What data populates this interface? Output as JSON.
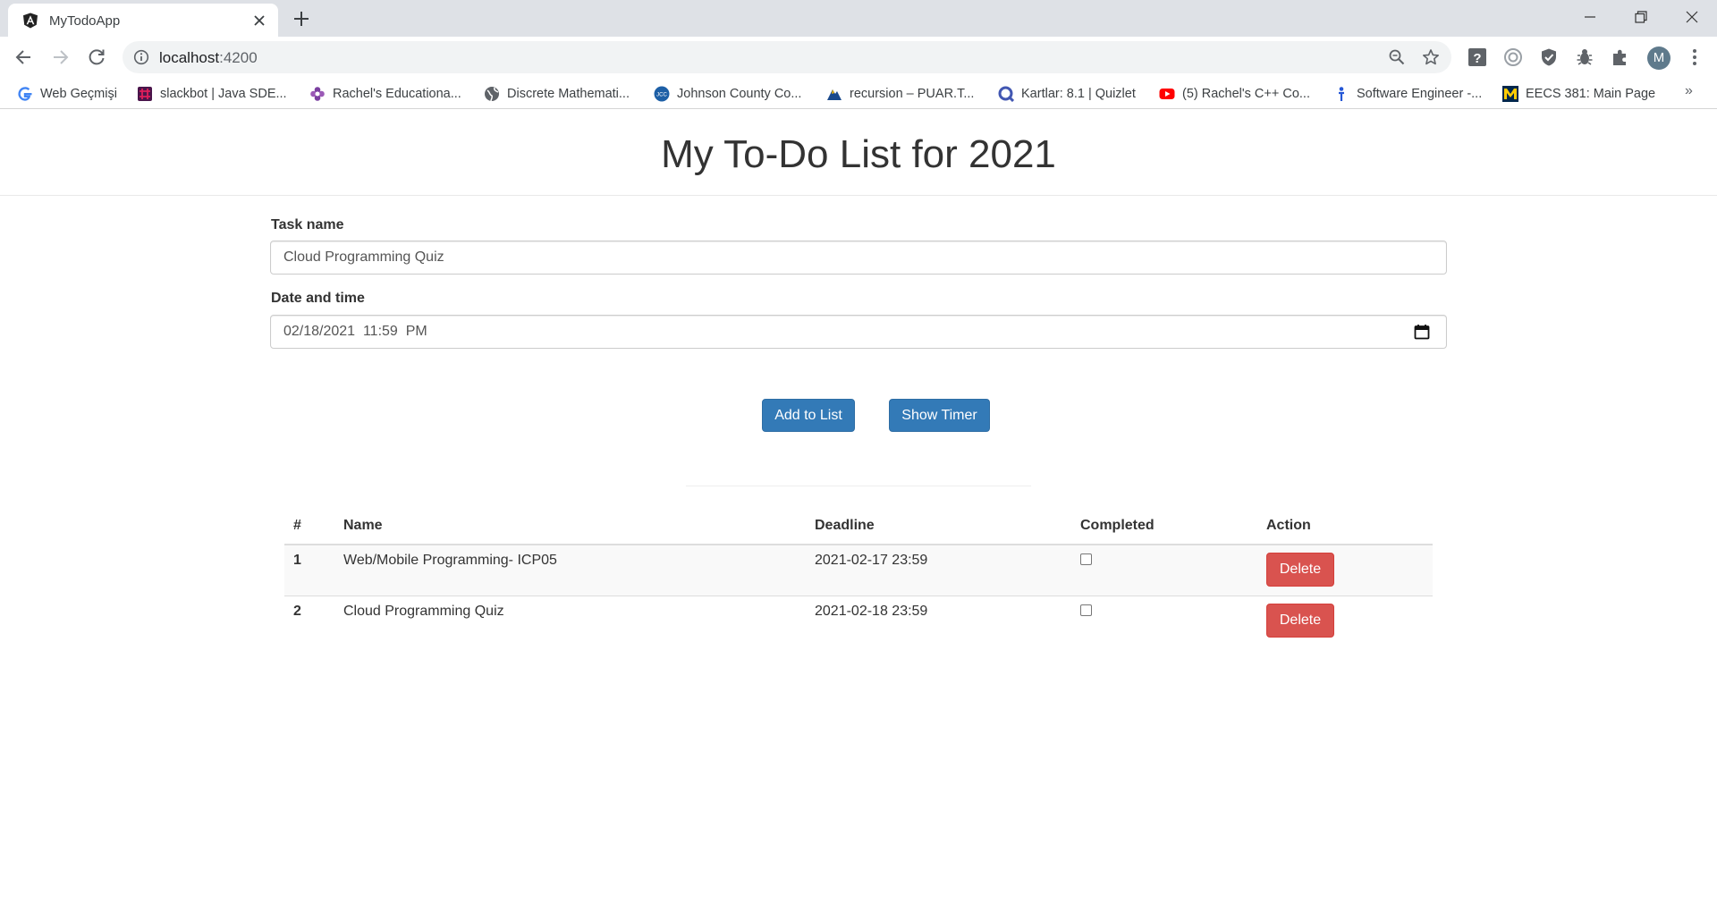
{
  "browser": {
    "tab_title": "MyTodoApp",
    "url_host": "localhost",
    "url_port": ":4200",
    "avatar_letter": "M",
    "bookmarks": [
      {
        "label": "Web Geçmişi",
        "icon": "google-icon"
      },
      {
        "label": "slackbot | Java SDE...",
        "icon": "slack-icon"
      },
      {
        "label": "Rachel's Educationa...",
        "icon": "flower-icon"
      },
      {
        "label": "Discrete Mathemati...",
        "icon": "globe-icon"
      },
      {
        "label": "Johnson County Co...",
        "icon": "jccc-icon"
      },
      {
        "label": "recursion – PUAR.T...",
        "icon": "mountain-icon"
      },
      {
        "label": "Kartlar: 8.1 | Quizlet",
        "icon": "quizlet-icon"
      },
      {
        "label": "(5) Rachel's C++ Co...",
        "icon": "youtube-icon"
      },
      {
        "label": "Software Engineer -...",
        "icon": "person-icon"
      },
      {
        "label": "EECS 381: Main Page",
        "icon": "michigan-icon"
      }
    ],
    "more_bookmarks": "»"
  },
  "page": {
    "title": "My To-Do List for 2021"
  },
  "form": {
    "task_label": "Task name",
    "task_value": "Cloud Programming Quiz",
    "date_label": "Date and time",
    "date_value": "02/18/2021  11:59  PM",
    "add_button": "Add to List",
    "timer_button": "Show Timer"
  },
  "table": {
    "headers": [
      "#",
      "Name",
      "Deadline",
      "Completed",
      "Action"
    ],
    "rows": [
      {
        "num": "1",
        "name": "Web/Mobile Programming- ICP05",
        "deadline": "2021-02-17 23:59",
        "completed": false,
        "action": "Delete"
      },
      {
        "num": "2",
        "name": "Cloud Programming Quiz",
        "deadline": "2021-02-18 23:59",
        "completed": false,
        "action": "Delete"
      }
    ]
  },
  "colors": {
    "primary": "#337ab7",
    "danger": "#d9534f"
  }
}
